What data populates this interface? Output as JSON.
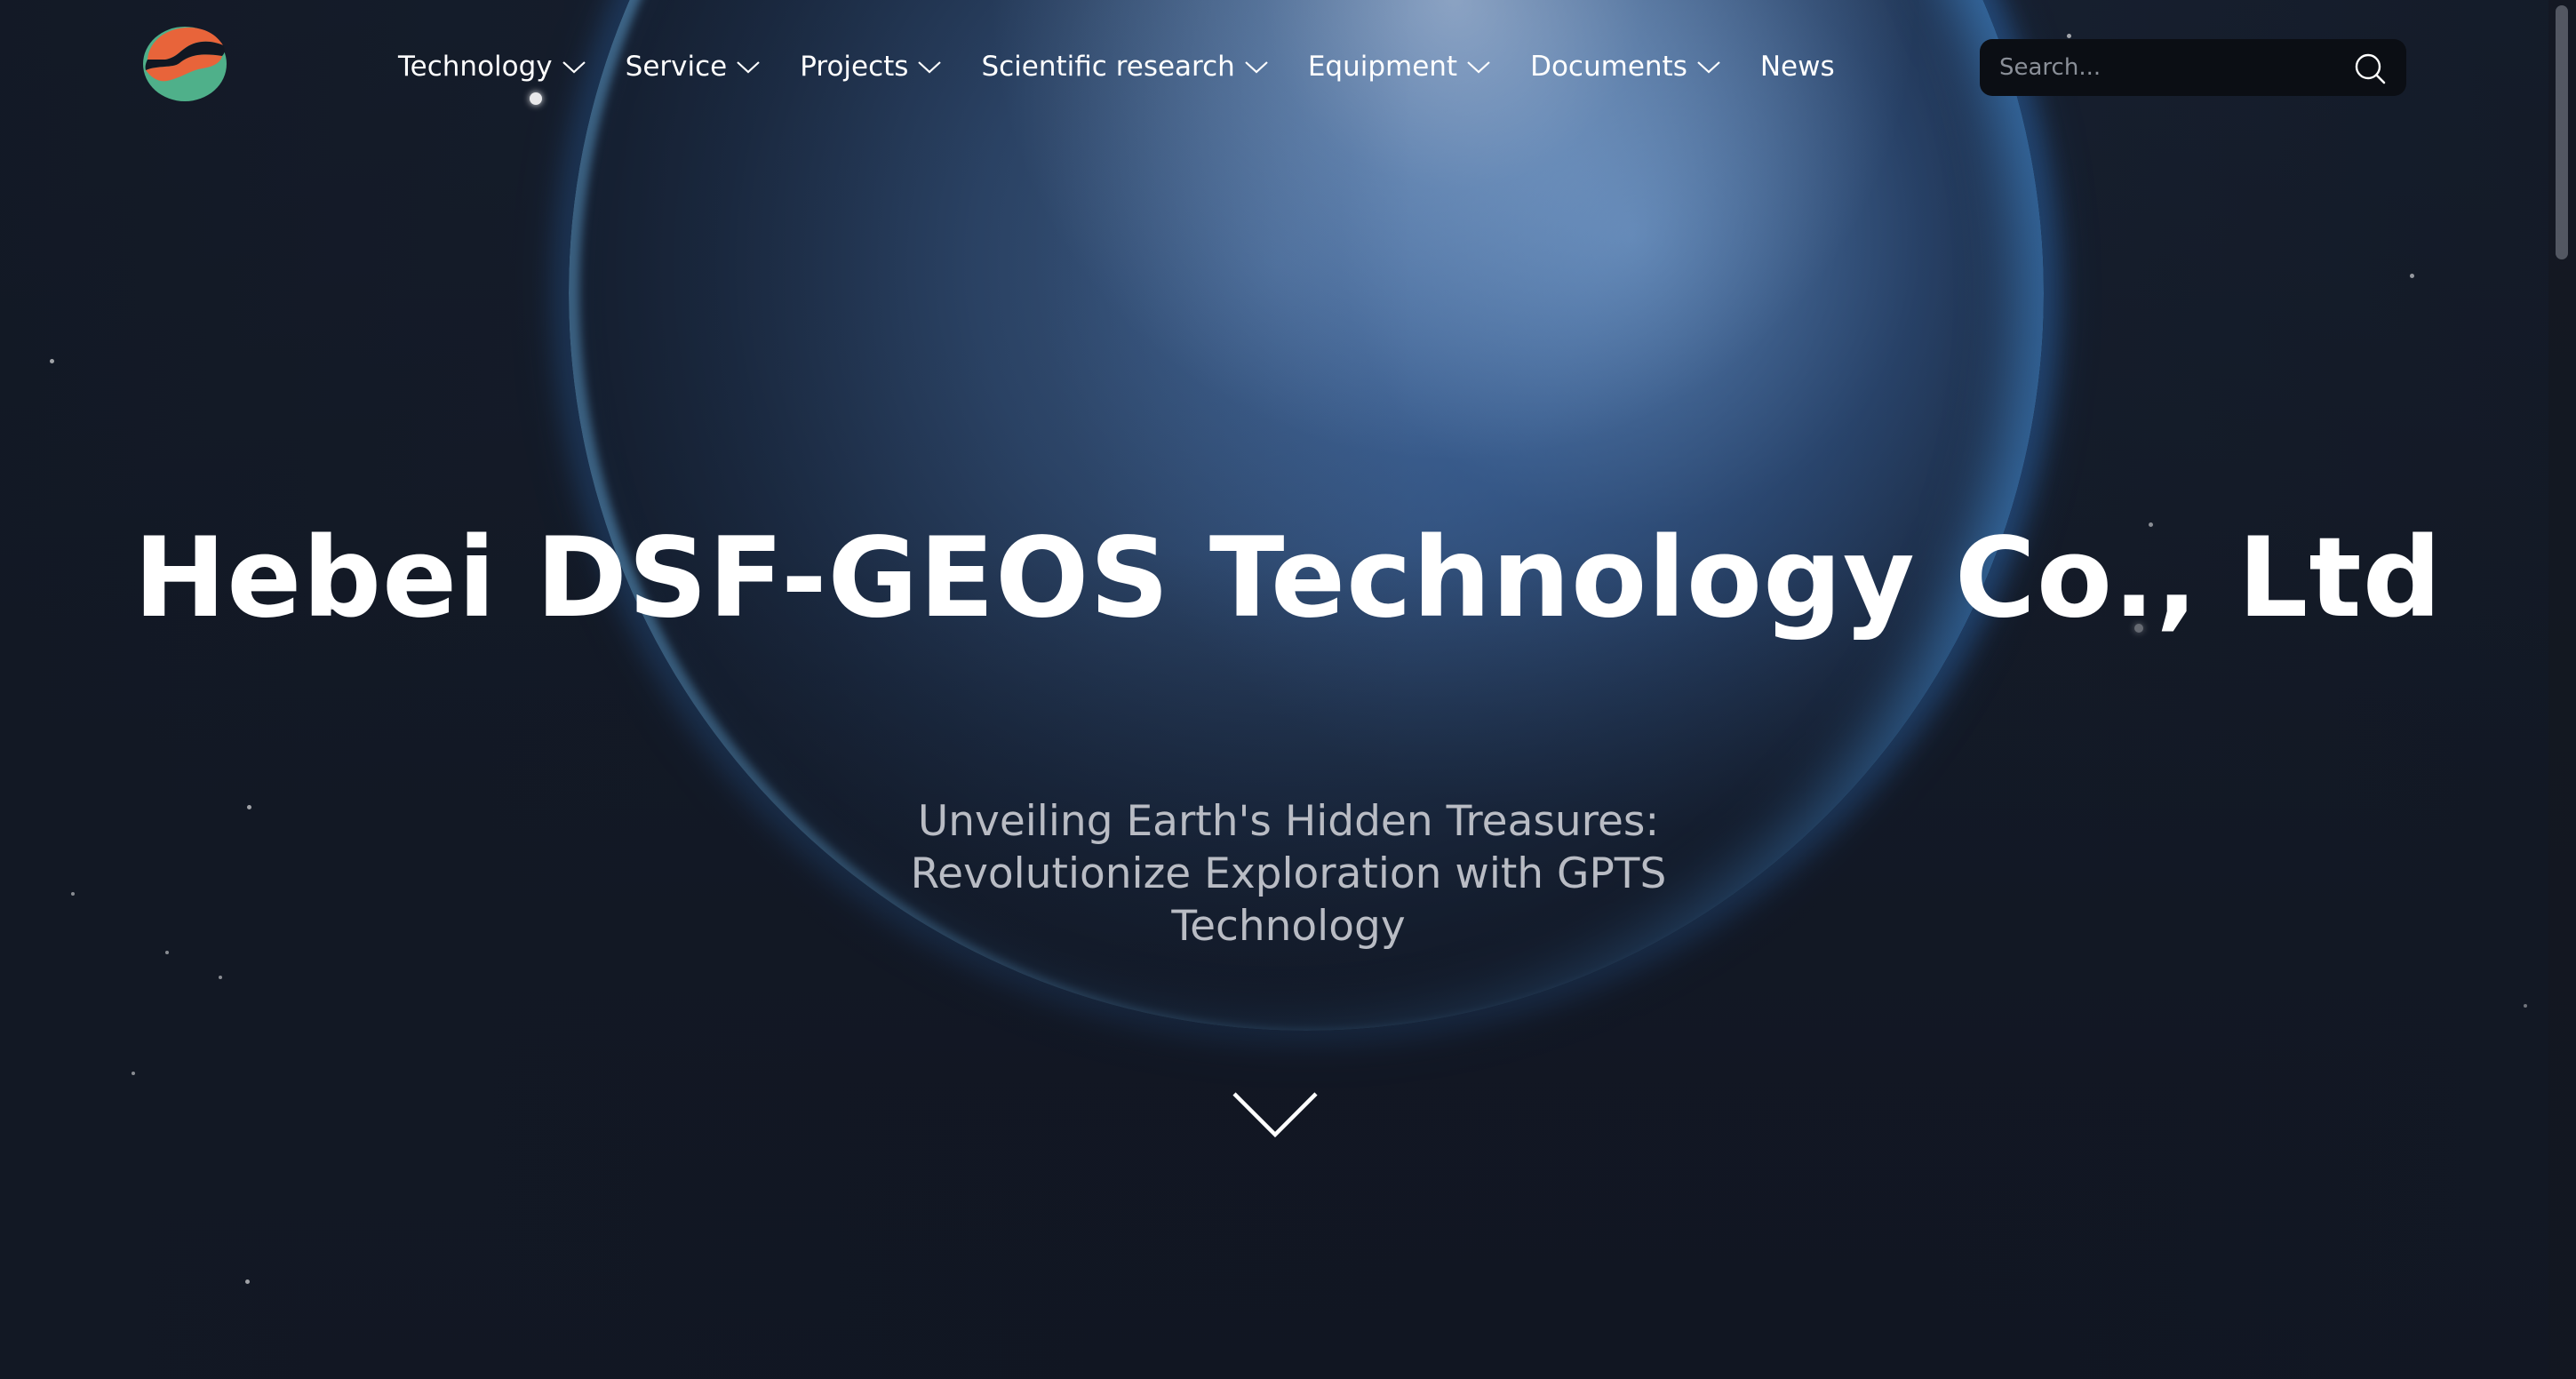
{
  "header": {
    "nav": [
      {
        "label": "Technology",
        "has_dropdown": true
      },
      {
        "label": "Service",
        "has_dropdown": true
      },
      {
        "label": "Projects",
        "has_dropdown": true
      },
      {
        "label": "Scientific research",
        "has_dropdown": true
      },
      {
        "label": "Equipment",
        "has_dropdown": true
      },
      {
        "label": "Documents",
        "has_dropdown": true
      },
      {
        "label": "News",
        "has_dropdown": false
      }
    ],
    "search": {
      "placeholder": "Search...",
      "value": ""
    }
  },
  "hero": {
    "title": "Hebei DSF-GEOS Technology Co., Ltd",
    "subtitle": "Unveiling Earth's Hidden Treasures: Revolutionize Exploration with GPTS Technology"
  },
  "colors": {
    "background": "#121826",
    "text": "#ffffff",
    "subtitle_text": "#b9bcc4",
    "search_bg": "#0b0e14",
    "logo_orange": "#e8643a",
    "logo_green": "#4fb08a"
  },
  "icons": {
    "logo": "company-logo",
    "dropdown": "chevron-down-icon",
    "search": "search-icon",
    "scroll": "chevron-down-large-icon"
  }
}
